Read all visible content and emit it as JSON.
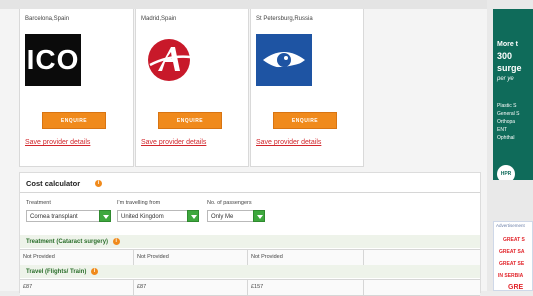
{
  "providers": [
    {
      "city": "Barcelona,Spain",
      "logo_text": "ICO",
      "enquire_label": "ENQUIRE",
      "link_label": "Save provider details"
    },
    {
      "city": "Madrid,Spain",
      "logo_icon": "stylized-a-logo-icon",
      "enquire_label": "ENQUIRE",
      "link_label": "Save provider details"
    },
    {
      "city": "St Petersburg,Russia",
      "logo_icon": "eye-logo-icon",
      "enquire_label": "ENQUIRE",
      "link_label": "Save provider details"
    }
  ],
  "calculator": {
    "title": "Cost calculator",
    "fields": [
      {
        "label": "Treatment",
        "value": "Cornea transplant"
      },
      {
        "label": "I'm travelling from",
        "value": "United Kingdom"
      },
      {
        "label": "No. of passengers",
        "value": "Only Me"
      }
    ],
    "sections": [
      {
        "title": "Treatment (Cataract surgery)",
        "cells": [
          "Not Provided",
          "Not Provided",
          "Not Provided"
        ]
      },
      {
        "title": "Travel (Flights/ Train)",
        "cells": [
          "£87",
          "£87",
          "£157"
        ]
      }
    ]
  },
  "sidebar": {
    "ad1_lines": [
      "More t",
      "300",
      "surge",
      "per ye",
      "Plastic S",
      "General S",
      "Orthopa",
      "ENT",
      "Ophthal"
    ],
    "ad1_logo": "HPR",
    "ad2_label": "Advertisement",
    "ad2_lines": [
      "GREAT S",
      "GREAT SA",
      "GREAT SE",
      "IN SERBIA",
      "GRE"
    ]
  },
  "colors": {
    "accent": "#f08a1c",
    "link": "#d2262c",
    "go": "#3ea83e",
    "ad_green": "#0f6b5a"
  }
}
